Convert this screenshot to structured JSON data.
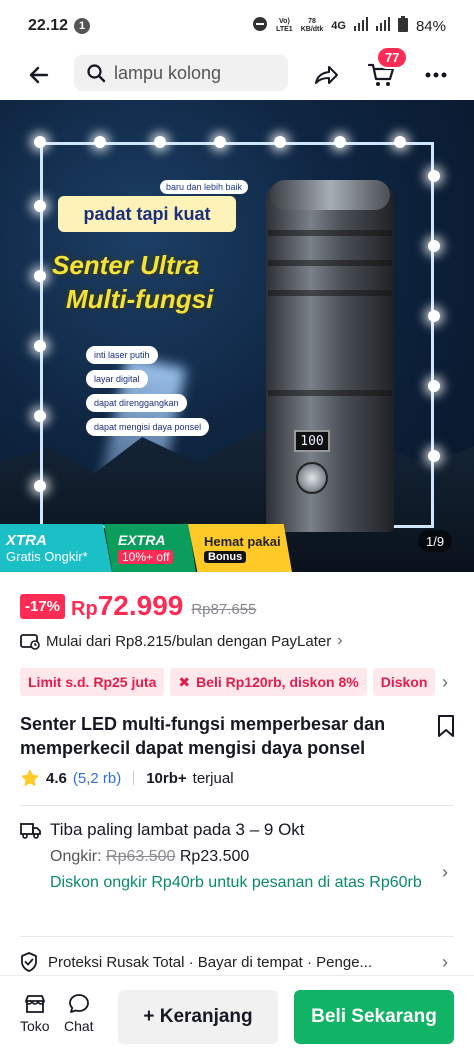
{
  "status_bar": {
    "time": "22.12",
    "notif_count": "1",
    "volte": "Vo)\nLTE1",
    "speed": "78\nKB/dtk",
    "network": "4G",
    "battery": "84%"
  },
  "topnav": {
    "search_value": "lampu kolong",
    "cart_count": "77",
    "icons": [
      "back-arrow-icon",
      "search-icon",
      "share-icon",
      "cart-icon",
      "more-icon"
    ]
  },
  "hero": {
    "tagline_small": "baru dan lebih baik",
    "tagline": "padat tapi kuat",
    "title_line1": "Senter Ultra",
    "title_line2": "Multi-fungsi",
    "features": [
      "inti laser putih",
      "layar digital",
      "dapat direnggangkan",
      "dapat mengisi daya ponsel"
    ],
    "display_value": "100",
    "pager": "1/9",
    "promos": [
      {
        "title": "XTRA",
        "sub": "Gratis Ongkir*"
      },
      {
        "title": "EXTRA",
        "sub": "10%+ off"
      },
      {
        "title": "Hemat pakai",
        "sub": "Bonus"
      }
    ]
  },
  "price": {
    "discount": "-17%",
    "currency": "Rp",
    "value": "72.999",
    "original": "Rp87.655"
  },
  "paylater": {
    "text": "Mulai dari Rp8.215/bulan dengan PayLater"
  },
  "chips": [
    "Limit s.d. Rp25 juta",
    "Beli Rp120rb, diskon 8%",
    "Diskon"
  ],
  "product": {
    "title": " Senter LED multi-fungsi memperbesar dan memperkecil dapat mengisi daya ponsel",
    "rating": "4.6",
    "rating_count": "(5,2 rb)",
    "sold": "10rb+",
    "sold_label": "terjual"
  },
  "shipping": {
    "eta": "Tiba paling lambat pada 3 – 9 Okt",
    "fee_label": "Ongkir:",
    "fee_original": "Rp63.500",
    "fee_new": "Rp23.500",
    "discount_note": "Diskon ongkir Rp40rb untuk pesanan di atas Rp60rb"
  },
  "protection": {
    "text": "Proteksi Rusak Total · Bayar di tempat · Penge..."
  },
  "bottombar": {
    "shop_label": "Toko",
    "chat_label": "Chat",
    "add_to_cart": "+ Keranjang",
    "buy_now": "Beli Sekarang"
  },
  "colors": {
    "accent": "#fe2c55",
    "buy_green": "#11b366",
    "ship_green": "#0a8a6d",
    "link_blue": "#2f6fd6"
  }
}
